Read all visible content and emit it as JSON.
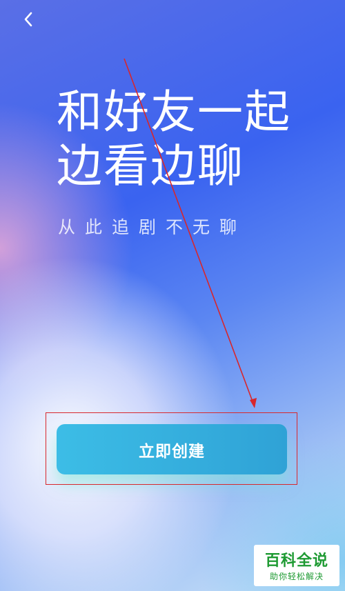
{
  "header": {
    "back_icon": "chevron-left-icon"
  },
  "hero": {
    "title_line_1": "和好友一起",
    "title_line_2": "边看边聊",
    "subtitle": "从此追剧不无聊"
  },
  "actions": {
    "create_label": "立即创建"
  },
  "watermark": {
    "brand": "百科全说",
    "tagline": "助你轻松解决"
  },
  "colors": {
    "annotation": "#d8262b",
    "button": "#2fa2d6",
    "watermark": "#1e9a32"
  }
}
